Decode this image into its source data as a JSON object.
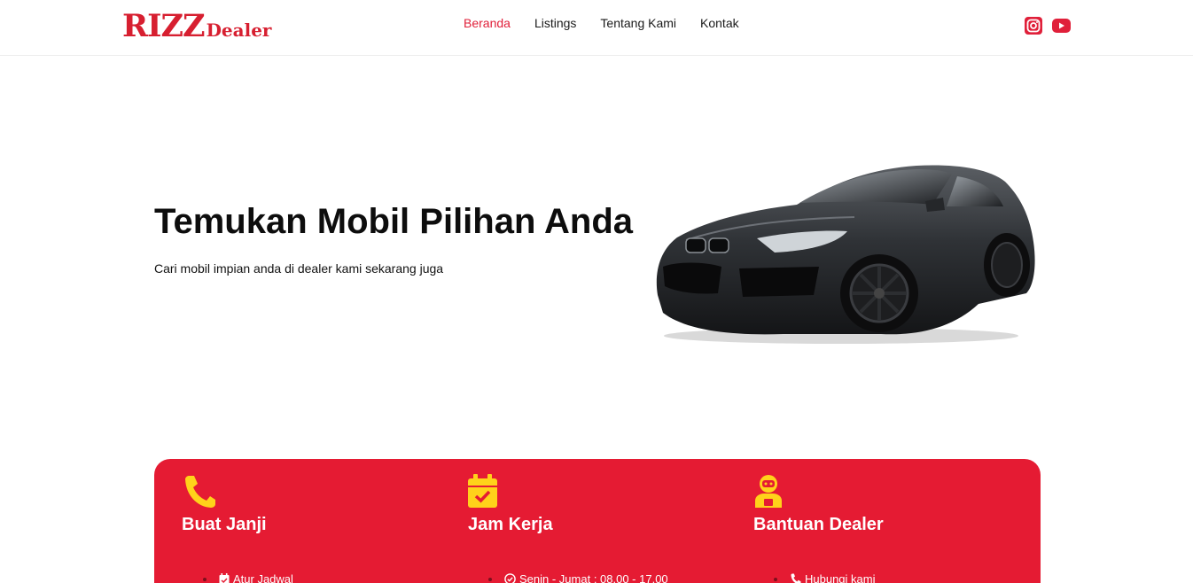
{
  "header": {
    "logo_main": "RIZZ",
    "logo_sub": "Dealer",
    "nav": [
      {
        "label": "Beranda",
        "active": true
      },
      {
        "label": "Listings",
        "active": false
      },
      {
        "label": "Tentang Kami",
        "active": false
      },
      {
        "label": "Kontak",
        "active": false
      }
    ],
    "social_icons": [
      "instagram-icon",
      "youtube-icon"
    ]
  },
  "hero": {
    "title": "Temukan Mobil Pilihan Anda",
    "subtitle": "Cari mobil impian anda di dealer kami sekarang juga",
    "image": "black-sports-car"
  },
  "info": {
    "columns": [
      {
        "icon": "phone-icon",
        "title": "Buat Janji",
        "item_icon": "calendar-check-icon",
        "item": "Atur Jadwal"
      },
      {
        "icon": "calendar-check-icon",
        "title": "Jam Kerja",
        "item_icon": "clock-check-icon",
        "item": "Senin - Jumat : 08.00 - 17.00"
      },
      {
        "icon": "support-agent-icon",
        "title": "Bantuan Dealer",
        "item_icon": "phone-icon",
        "item": "Hubungi kami"
      }
    ]
  },
  "colors": {
    "brand_red": "#e51b33",
    "logo_red": "#d71f30",
    "icon_yellow": "#ffd21a",
    "nav_active": "#e0203a"
  }
}
